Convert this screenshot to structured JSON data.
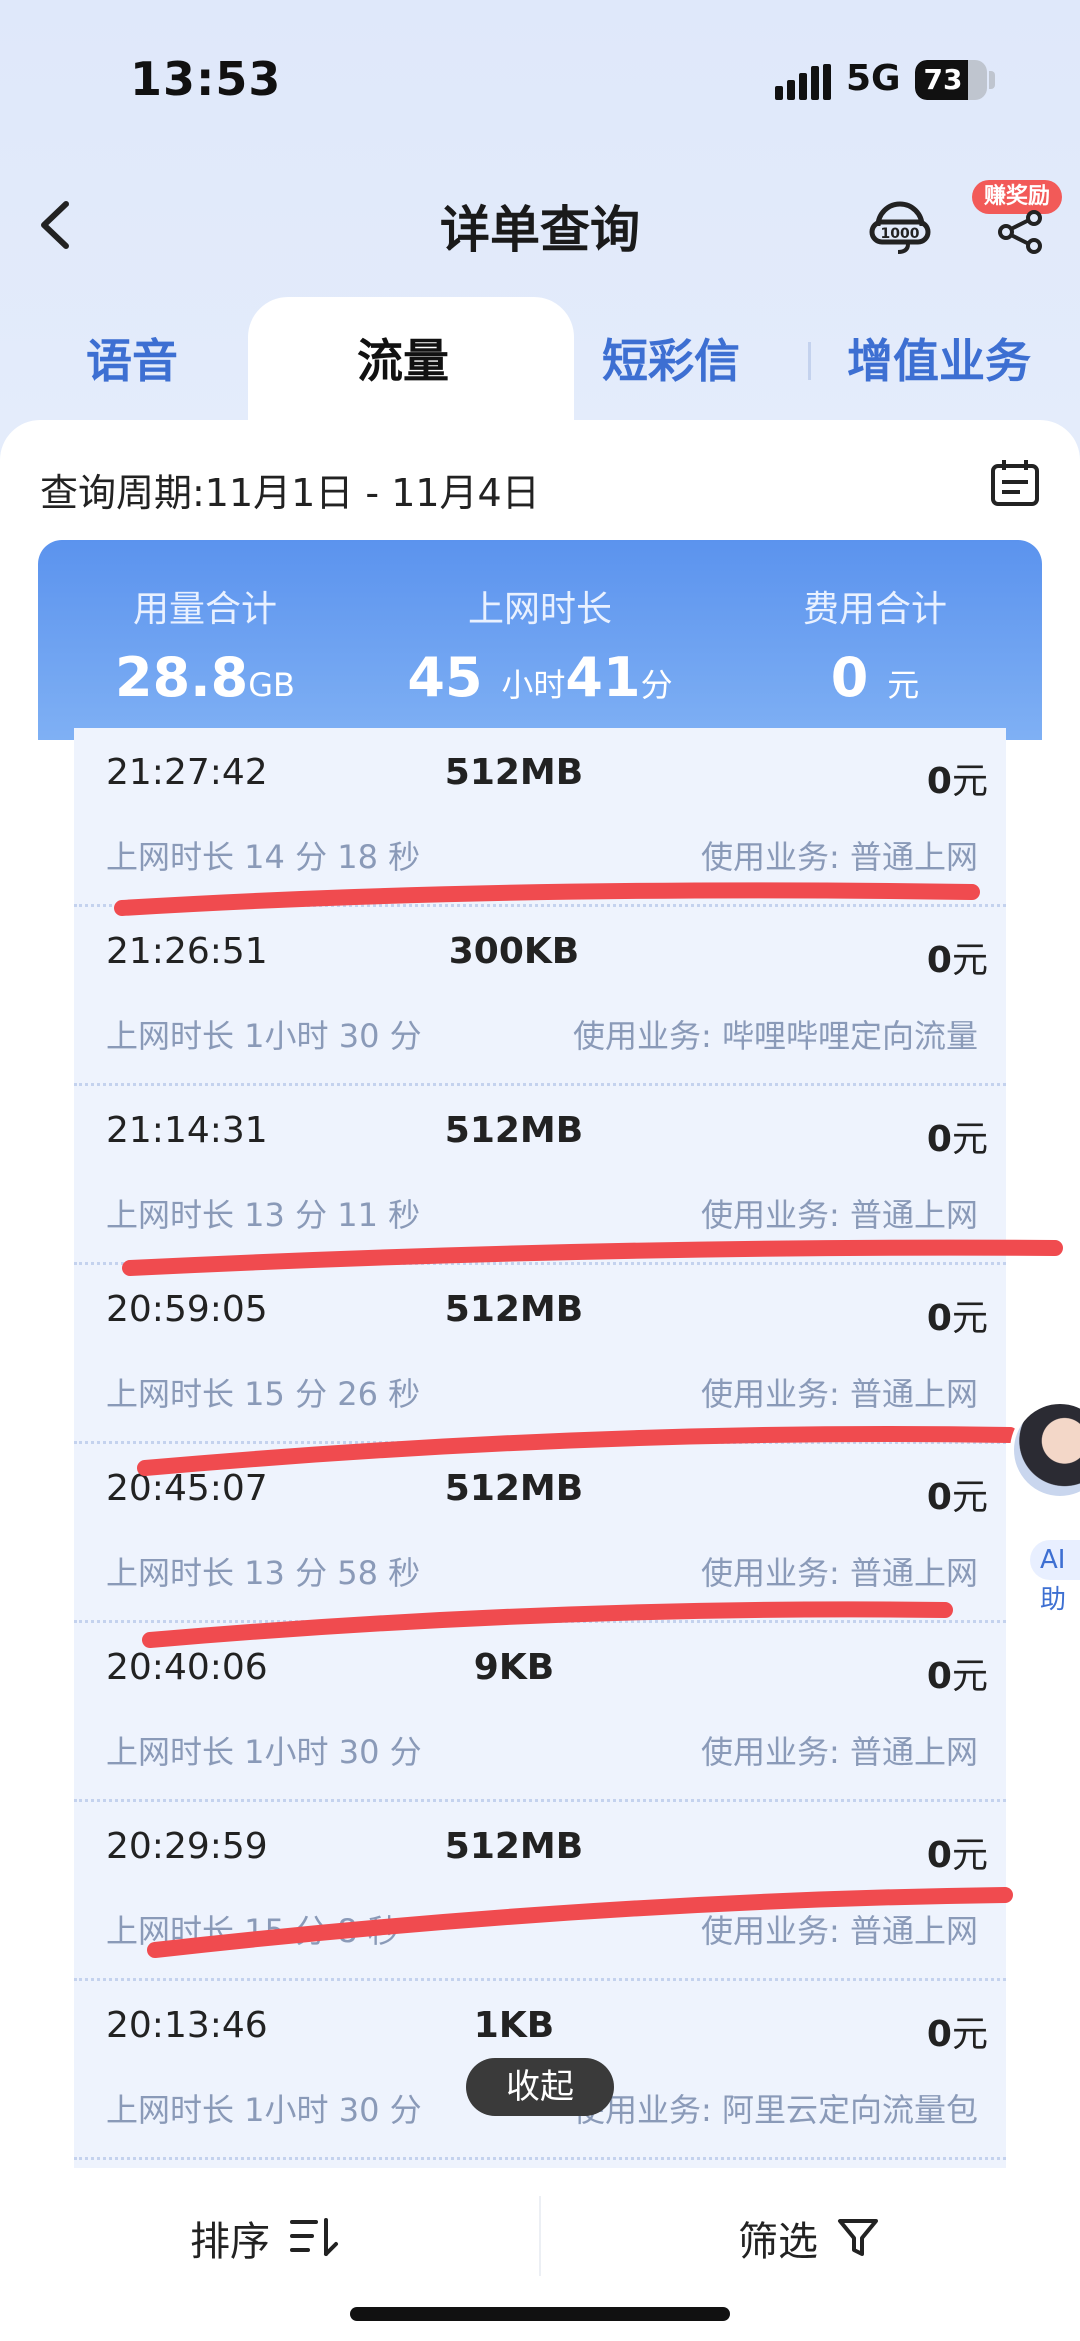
{
  "status_bar": {
    "time": "13:53",
    "network": "5G",
    "battery": "73",
    "battery_level": 0.73
  },
  "header": {
    "title": "详单查询",
    "reward_badge": "赚奖励"
  },
  "tabs": [
    {
      "label": "语音",
      "active": false
    },
    {
      "label": "流量",
      "active": true
    },
    {
      "label": "短彩信",
      "active": false
    },
    {
      "label": "增值业务",
      "active": false
    }
  ],
  "period": {
    "label": "查询周期:11月1日 - 11月4日"
  },
  "summary": {
    "usage_label": "用量合计",
    "usage_value": "28.8",
    "usage_unit": "GB",
    "duration_label": "上网时长",
    "duration_hours": "45",
    "duration_hours_unit": "小时",
    "duration_minutes": "41",
    "duration_minutes_unit": "分",
    "fee_label": "费用合计",
    "fee_value": "0",
    "fee_unit": "元"
  },
  "records": [
    {
      "time": "21:27:42",
      "data": "512MB",
      "fee": "0",
      "fee_unit": "元",
      "duration": "上网时长 14 分 18 秒",
      "service": "使用业务: 普通上网"
    },
    {
      "time": "21:26:51",
      "data": "300KB",
      "fee": "0",
      "fee_unit": "元",
      "duration": "上网时长 1小时 30 分",
      "service": "使用业务: 哔哩哔哩定向流量"
    },
    {
      "time": "21:14:31",
      "data": "512MB",
      "fee": "0",
      "fee_unit": "元",
      "duration": "上网时长 13 分 11 秒",
      "service": "使用业务: 普通上网"
    },
    {
      "time": "20:59:05",
      "data": "512MB",
      "fee": "0",
      "fee_unit": "元",
      "duration": "上网时长 15 分 26 秒",
      "service": "使用业务: 普通上网"
    },
    {
      "time": "20:45:07",
      "data": "512MB",
      "fee": "0",
      "fee_unit": "元",
      "duration": "上网时长 13 分 58 秒",
      "service": "使用业务: 普通上网"
    },
    {
      "time": "20:40:06",
      "data": "9KB",
      "fee": "0",
      "fee_unit": "元",
      "duration": "上网时长 1小时 30 分",
      "service": "使用业务: 普通上网"
    },
    {
      "time": "20:29:59",
      "data": "512MB",
      "fee": "0",
      "fee_unit": "元",
      "duration": "上网时长 15 分 8 秒",
      "service": "使用业务: 普通上网"
    },
    {
      "time": "20:13:46",
      "data": "1KB",
      "fee": "0",
      "fee_unit": "元",
      "duration": "上网时长 1小时 30 分",
      "service": "使用业务: 阿里云定向流量包"
    }
  ],
  "collapse_label": "收起",
  "ai_label": "AI助",
  "bottom_bar": {
    "sort_label": "排序",
    "filter_label": "筛选"
  },
  "colors": {
    "accent": "#3d6fd2",
    "summary_gradient_top": "#5b93ee",
    "annotation_red": "#f04b4f"
  },
  "icons": [
    "back-arrow-icon",
    "headset-service-icon",
    "share-icon",
    "calendar-icon",
    "sort-icon",
    "filter-icon",
    "signal-icon"
  ]
}
